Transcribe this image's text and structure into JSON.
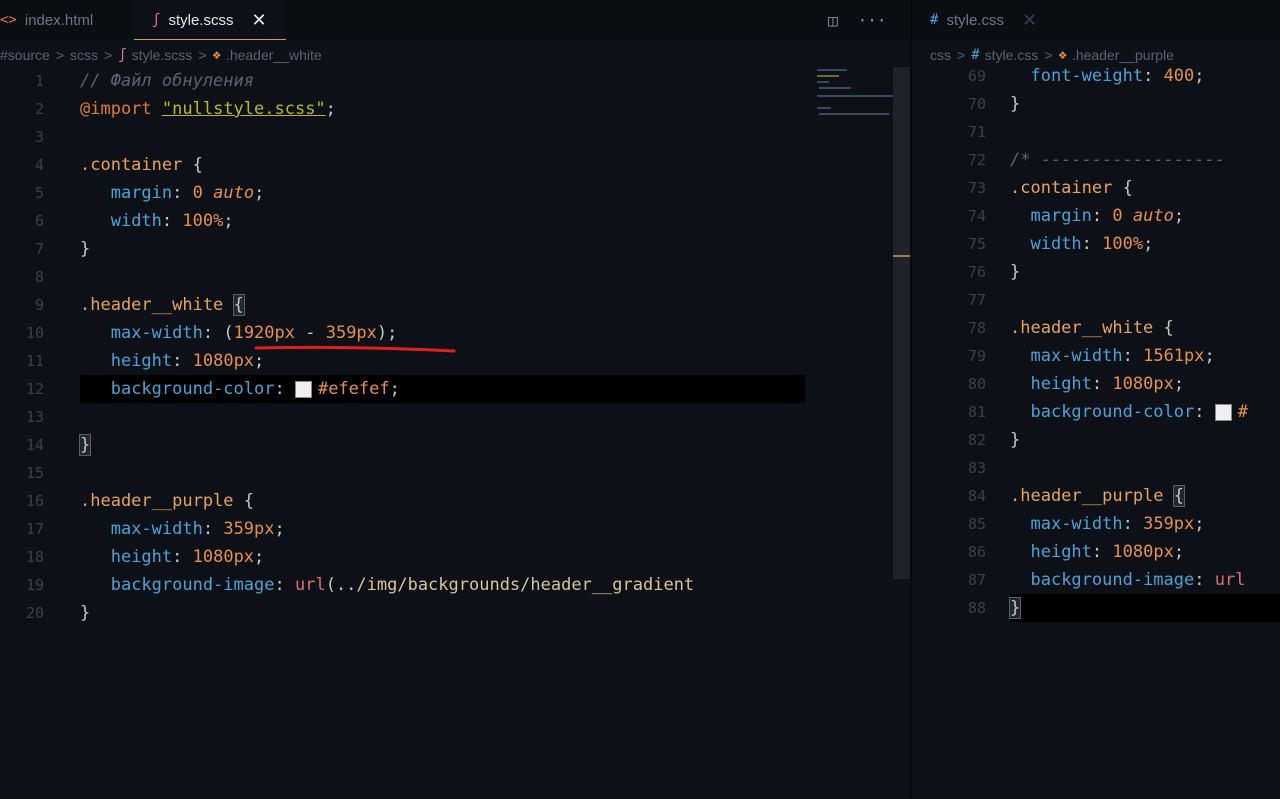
{
  "left": {
    "tabs": [
      {
        "icon": "<>",
        "label": "index.html",
        "active": false
      },
      {
        "icon": "ʃ",
        "label": "style.scss",
        "active": true
      }
    ],
    "tab_close_glyph": "✕",
    "actions": {
      "split": "◫",
      "more": "···"
    },
    "breadcrumb": [
      "#source",
      "scss",
      "style.scss",
      ".header__white"
    ],
    "breadcrumb_sep": ">",
    "lines": [
      {
        "n": "1",
        "tokens": [
          [
            "cm",
            "// Файл обнуления"
          ]
        ]
      },
      {
        "n": "2",
        "tokens": [
          [
            "at",
            "@import"
          ],
          [
            "punc",
            " "
          ],
          [
            "str",
            "\"nullstyle.scss\""
          ],
          [
            "punc",
            ";"
          ]
        ]
      },
      {
        "n": "3",
        "tokens": []
      },
      {
        "n": "4",
        "tokens": [
          [
            "sel",
            ".container"
          ],
          [
            "punc",
            " {"
          ]
        ]
      },
      {
        "n": "5",
        "tokens": [
          [
            "punc",
            "   "
          ],
          [
            "prop",
            "margin"
          ],
          [
            "punc",
            ": "
          ],
          [
            "num",
            "0"
          ],
          [
            "punc",
            " "
          ],
          [
            "kw",
            "auto"
          ],
          [
            "punc",
            ";"
          ]
        ]
      },
      {
        "n": "6",
        "tokens": [
          [
            "punc",
            "   "
          ],
          [
            "prop",
            "width"
          ],
          [
            "punc",
            ": "
          ],
          [
            "num",
            "100%"
          ],
          [
            "punc",
            ";"
          ]
        ]
      },
      {
        "n": "7",
        "tokens": [
          [
            "punc",
            "}"
          ]
        ]
      },
      {
        "n": "8",
        "tokens": []
      },
      {
        "n": "9",
        "tokens": [
          [
            "sel",
            ".header__white"
          ],
          [
            "punc",
            " "
          ],
          [
            "hl-brace",
            "{"
          ]
        ]
      },
      {
        "n": "10",
        "tokens": [
          [
            "punc",
            "   "
          ],
          [
            "prop",
            "max-width"
          ],
          [
            "punc",
            ": "
          ],
          [
            "punc",
            "("
          ],
          [
            "num",
            "1920px"
          ],
          [
            "punc",
            " - "
          ],
          [
            "num",
            "359px"
          ],
          [
            "punc",
            ");"
          ]
        ]
      },
      {
        "n": "11",
        "tokens": [
          [
            "punc",
            "   "
          ],
          [
            "prop",
            "height"
          ],
          [
            "punc",
            ": "
          ],
          [
            "num",
            "1080px"
          ],
          [
            "punc",
            ";"
          ]
        ]
      },
      {
        "n": "12",
        "tokens": [
          [
            "punc",
            "   "
          ],
          [
            "prop",
            "background-color"
          ],
          [
            "punc",
            ": "
          ],
          [
            "swatch",
            ""
          ],
          [
            "num",
            "#efefef"
          ],
          [
            "punc",
            ";"
          ]
        ]
      },
      {
        "n": "13",
        "tokens": []
      },
      {
        "n": "14",
        "tokens": [
          [
            "hl-brace",
            "}"
          ]
        ]
      },
      {
        "n": "15",
        "tokens": []
      },
      {
        "n": "16",
        "tokens": [
          [
            "sel",
            ".header__purple"
          ],
          [
            "punc",
            " {"
          ]
        ]
      },
      {
        "n": "17",
        "tokens": [
          [
            "punc",
            "   "
          ],
          [
            "prop",
            "max-width"
          ],
          [
            "punc",
            ": "
          ],
          [
            "num",
            "359px"
          ],
          [
            "punc",
            ";"
          ]
        ]
      },
      {
        "n": "18",
        "tokens": [
          [
            "punc",
            "   "
          ],
          [
            "prop",
            "height"
          ],
          [
            "punc",
            ": "
          ],
          [
            "num",
            "1080px"
          ],
          [
            "punc",
            ";"
          ]
        ]
      },
      {
        "n": "19",
        "tokens": [
          [
            "punc",
            "   "
          ],
          [
            "prop",
            "background-image"
          ],
          [
            "punc",
            ": "
          ],
          [
            "fn",
            "url"
          ],
          [
            "punc",
            "("
          ],
          [
            "url",
            "../img/backgrounds/header__gradient"
          ]
        ]
      },
      {
        "n": "20",
        "tokens": [
          [
            "punc",
            "}"
          ]
        ]
      }
    ]
  },
  "right": {
    "tabs": [
      {
        "icon": "#",
        "label": "style.css",
        "active": false
      }
    ],
    "tab_close_glyph": "✕",
    "breadcrumb": [
      "css",
      "style.css",
      ".header__purple"
    ],
    "breadcrumb_sep": ">",
    "lines": [
      {
        "n": "69",
        "tokens": [
          [
            "punc",
            "  "
          ],
          [
            "prop",
            "font-weight"
          ],
          [
            "punc",
            ": "
          ],
          [
            "num",
            "400"
          ],
          [
            "punc",
            ";"
          ]
        ]
      },
      {
        "n": "70",
        "tokens": [
          [
            "punc",
            "}"
          ]
        ]
      },
      {
        "n": "71",
        "tokens": []
      },
      {
        "n": "72",
        "tokens": [
          [
            "cm",
            "/* ------------------"
          ]
        ]
      },
      {
        "n": "73",
        "tokens": [
          [
            "sel",
            ".container"
          ],
          [
            "punc",
            " {"
          ]
        ]
      },
      {
        "n": "74",
        "tokens": [
          [
            "punc",
            "  "
          ],
          [
            "prop",
            "margin"
          ],
          [
            "punc",
            ": "
          ],
          [
            "num",
            "0"
          ],
          [
            "punc",
            " "
          ],
          [
            "kw",
            "auto"
          ],
          [
            "punc",
            ";"
          ]
        ]
      },
      {
        "n": "75",
        "tokens": [
          [
            "punc",
            "  "
          ],
          [
            "prop",
            "width"
          ],
          [
            "punc",
            ": "
          ],
          [
            "num",
            "100%"
          ],
          [
            "punc",
            ";"
          ]
        ]
      },
      {
        "n": "76",
        "tokens": [
          [
            "punc",
            "}"
          ]
        ]
      },
      {
        "n": "77",
        "tokens": []
      },
      {
        "n": "78",
        "tokens": [
          [
            "sel",
            ".header__white"
          ],
          [
            "punc",
            " {"
          ]
        ]
      },
      {
        "n": "79",
        "tokens": [
          [
            "punc",
            "  "
          ],
          [
            "prop",
            "max-width"
          ],
          [
            "punc",
            ": "
          ],
          [
            "num",
            "1561px"
          ],
          [
            "punc",
            ";"
          ]
        ]
      },
      {
        "n": "80",
        "tokens": [
          [
            "punc",
            "  "
          ],
          [
            "prop",
            "height"
          ],
          [
            "punc",
            ": "
          ],
          [
            "num",
            "1080px"
          ],
          [
            "punc",
            ";"
          ]
        ]
      },
      {
        "n": "81",
        "tokens": [
          [
            "punc",
            "  "
          ],
          [
            "prop",
            "background-color"
          ],
          [
            "punc",
            ": "
          ],
          [
            "swatch",
            ""
          ],
          [
            "num",
            "#"
          ]
        ]
      },
      {
        "n": "82",
        "tokens": [
          [
            "punc",
            "}"
          ]
        ]
      },
      {
        "n": "83",
        "tokens": []
      },
      {
        "n": "84",
        "tokens": [
          [
            "sel",
            ".header__purple"
          ],
          [
            "punc",
            " "
          ],
          [
            "hl-brace",
            "{"
          ]
        ]
      },
      {
        "n": "85",
        "tokens": [
          [
            "punc",
            "  "
          ],
          [
            "prop",
            "max-width"
          ],
          [
            "punc",
            ": "
          ],
          [
            "num",
            "359px"
          ],
          [
            "punc",
            ";"
          ]
        ]
      },
      {
        "n": "86",
        "tokens": [
          [
            "punc",
            "  "
          ],
          [
            "prop",
            "height"
          ],
          [
            "punc",
            ": "
          ],
          [
            "num",
            "1080px"
          ],
          [
            "punc",
            ";"
          ]
        ]
      },
      {
        "n": "87",
        "tokens": [
          [
            "punc",
            "  "
          ],
          [
            "prop",
            "background-image"
          ],
          [
            "punc",
            ": "
          ],
          [
            "fn",
            "url"
          ]
        ]
      },
      {
        "n": "88",
        "tokens": [
          [
            "hl-brace",
            "}"
          ]
        ]
      }
    ]
  },
  "annotation_color": "#e0201c",
  "active_tab_accent": "#d49a4a"
}
